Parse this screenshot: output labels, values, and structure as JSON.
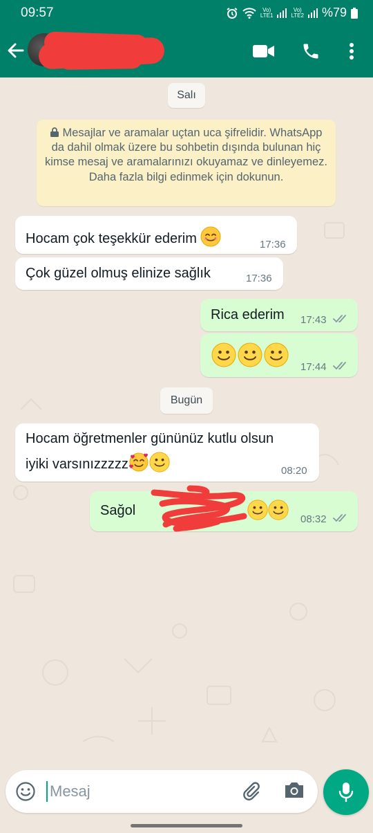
{
  "status_bar": {
    "time": "09:57",
    "sim1": "LTE1",
    "sim2": "LTE2",
    "battery": "%79",
    "icons": [
      "alarm-icon",
      "wifi-icon",
      "signal-icon",
      "battery-icon"
    ]
  },
  "header": {
    "icons": [
      "back-arrow-icon",
      "video-call-icon",
      "voice-call-icon",
      "more-options-icon"
    ],
    "accent_color": "#008069"
  },
  "chat": {
    "date_1": "Salı",
    "encryption_notice": "Mesajlar ve aramalar uçtan uca şifrelidir. WhatsApp da dahil olmak üzere bu sohbetin dışında bulunan hiç kimse mesaj ve aramalarınızı okuyamaz ve dinleyemez. Daha fazla bilgi edinmek için dokunun.",
    "date_2": "Bugün",
    "messages": [
      {
        "direction": "in",
        "text": "Hocam çok teşekkür ederim",
        "emoji": "smiling-face-icon",
        "time": "17:36"
      },
      {
        "direction": "in",
        "text": "Çok güzel olmuş elinize sağlık",
        "time": "17:36"
      },
      {
        "direction": "out",
        "text": "Rica ederim",
        "time": "17:43",
        "status": "read"
      },
      {
        "direction": "out",
        "text": "",
        "emoji": "slightly-smiling-face-icon x3",
        "time": "17:44",
        "status": "read"
      },
      {
        "direction": "in",
        "text_line1": "Hocam öğretmenler gününüz kutlu olsun",
        "text_line2": "iyiki varsınızzzzz",
        "emoji": "smiling-face-with-hearts-icon, slightly-smiling-face-icon",
        "time": "08:20"
      },
      {
        "direction": "out",
        "text": "Sağol",
        "emoji": "slightly-smiling-face-icon x2",
        "time": "08:32",
        "status": "read"
      }
    ]
  },
  "composer": {
    "placeholder": "Mesaj",
    "icons": [
      "emoji-icon",
      "attach-icon",
      "camera-icon",
      "mic-icon"
    ]
  }
}
